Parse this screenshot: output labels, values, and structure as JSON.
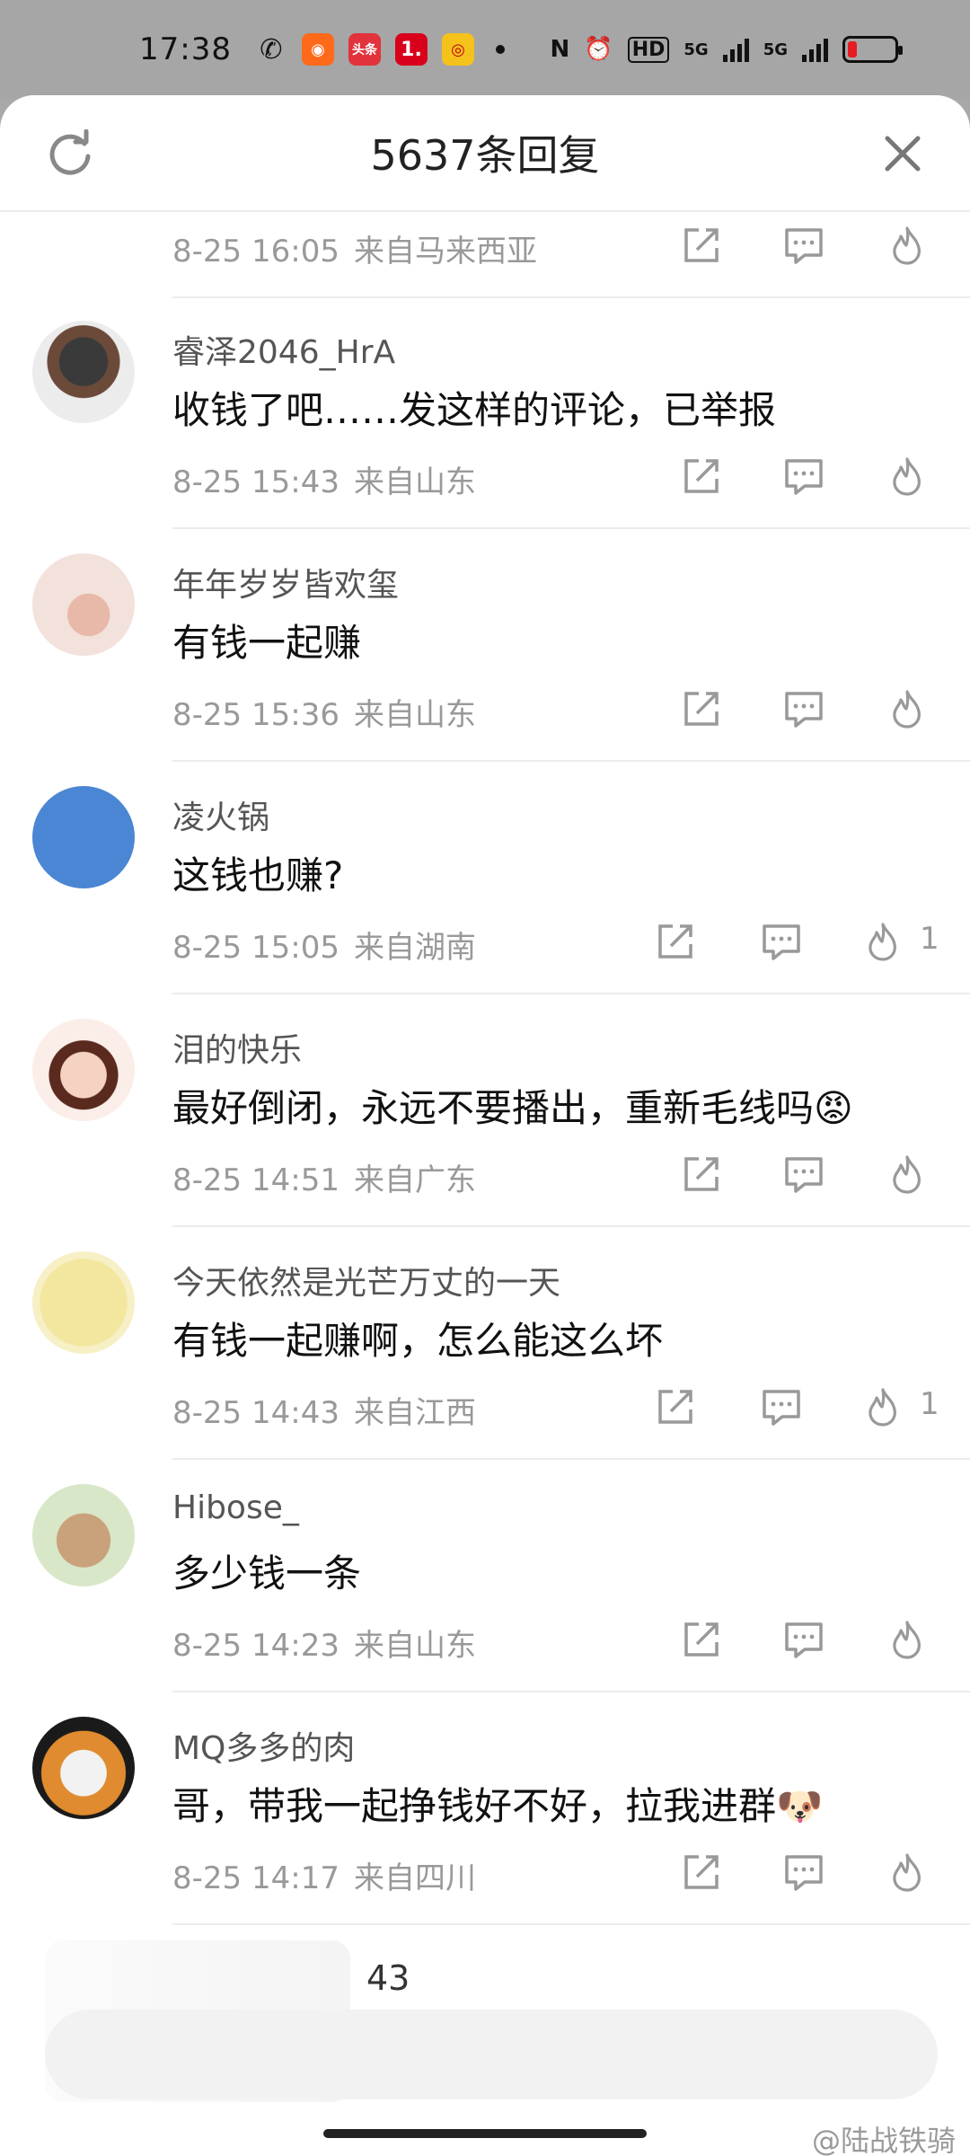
{
  "status_bar": {
    "time": "17:38",
    "apps": [
      "wechat-icon",
      "kuaishou-icon",
      "toutiao-icon",
      "one-icon",
      "weibo-icon"
    ],
    "toutiao_label": "头条",
    "one_label": "1.",
    "right_icons": [
      "nfc-icon",
      "alarm-icon",
      "hd-icon",
      "5g-signal-icon",
      "5g-signal-icon",
      "battery-icon"
    ],
    "hd_label": "HD",
    "net1": "5G",
    "net2": "5G"
  },
  "sheet": {
    "title": "5637条回复"
  },
  "comments": [
    {
      "name": "",
      "text": "",
      "date": "8-25 16:05",
      "location": "来自马来西亚",
      "likes": ""
    },
    {
      "name": "睿泽2046_HrA",
      "text": "收钱了吧……发这样的评论，已举报",
      "date": "8-25 15:43",
      "location": "来自山东",
      "likes": ""
    },
    {
      "name": "年年岁岁皆欢玺",
      "text": "有钱一起赚",
      "date": "8-25 15:36",
      "location": "来自山东",
      "likes": ""
    },
    {
      "name": "凌火锅",
      "text": "这钱也赚?",
      "date": "8-25 15:05",
      "location": "来自湖南",
      "likes": "1"
    },
    {
      "name": "泪的快乐",
      "text": "最好倒闭，永远不要播出，重新毛线吗😡",
      "date": "8-25 14:51",
      "location": "来自广东",
      "likes": ""
    },
    {
      "name": "今天依然是光芒万丈的一天",
      "text": "有钱一起赚啊，怎么能这么坏",
      "date": "8-25 14:43",
      "location": "来自江西",
      "likes": "1"
    },
    {
      "name": "Hibose_",
      "text": "多少钱一条",
      "date": "8-25 14:23",
      "location": "来自山东",
      "likes": ""
    },
    {
      "name": "MQ多多的肉",
      "text": "哥，带我一起挣钱好不好，拉我进群🐶",
      "date": "8-25 14:17",
      "location": "来自四川",
      "likes": ""
    }
  ],
  "bottom_count": "43",
  "watermark": "@陆战铁骑",
  "colors": {
    "accent_avatar_blue": "#4a86d4",
    "battery_low": "#e81b23"
  }
}
